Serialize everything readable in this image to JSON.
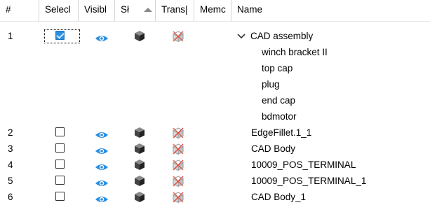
{
  "columns": {
    "num": "#",
    "select": "Selecl",
    "visible": "Visibl",
    "shaded": "Sł",
    "transparent": "Trans|",
    "memo": "Memc",
    "name": "Name"
  },
  "icons": {
    "sort": "sort-ascending-icon",
    "visible": "eye-icon",
    "shaded": "cube-icon",
    "transparent": "transparency-cube-icon",
    "expand": "chevron-down-icon"
  },
  "colors": {
    "checkbox_checked": "#2a8fe0",
    "eye": "#2b8fe0",
    "cube": "#444444",
    "transparency_strike": "#e24b3c"
  },
  "rows": [
    {
      "num": "1",
      "selected": true,
      "name": "CAD assembly",
      "expanded": true,
      "children": [
        "winch bracket II",
        "top cap",
        "plug",
        "end cap",
        "bdmotor"
      ]
    },
    {
      "num": "2",
      "selected": false,
      "name": "EdgeFillet.1_1"
    },
    {
      "num": "3",
      "selected": false,
      "name": "CAD Body"
    },
    {
      "num": "4",
      "selected": false,
      "name": "10009_POS_TERMINAL"
    },
    {
      "num": "5",
      "selected": false,
      "name": "10009_POS_TERMINAL_1"
    },
    {
      "num": "6",
      "selected": false,
      "name": "CAD Body_1"
    }
  ],
  "expand_glyph": "⌄"
}
